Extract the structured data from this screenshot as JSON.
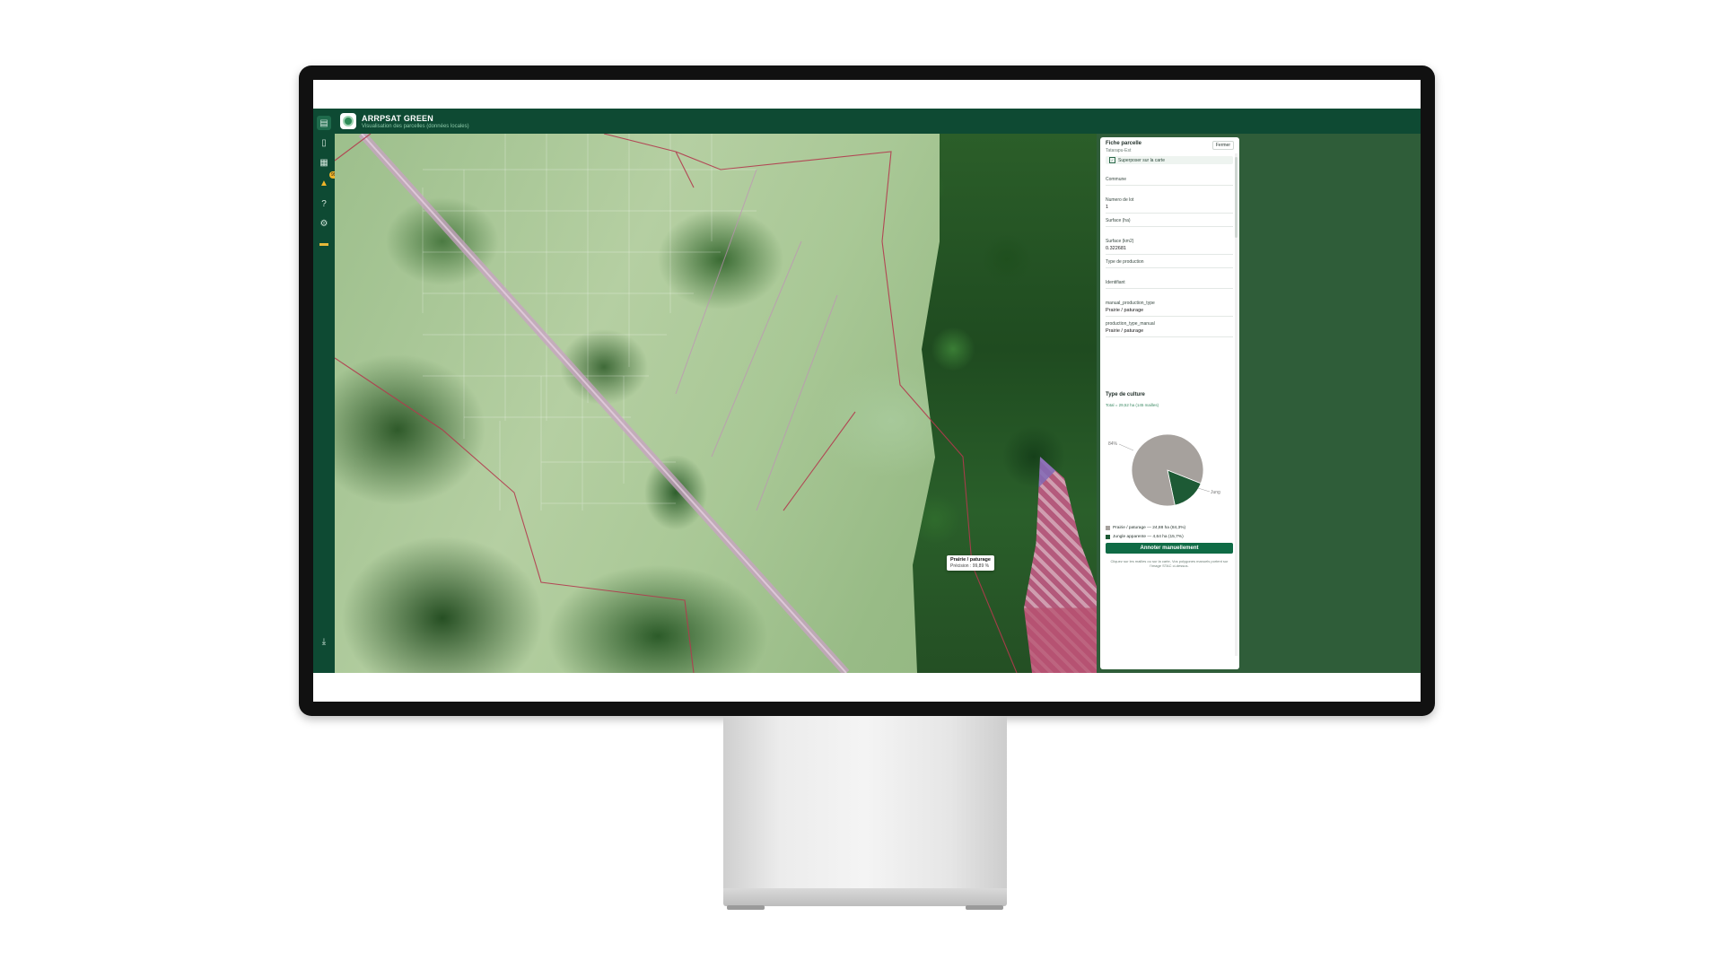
{
  "app": {
    "title": "ARRPSAT GREEN",
    "subtitle": "Visualisation des parcelles (données locales)"
  },
  "sidebar": {
    "items": [
      {
        "name": "layers-icon",
        "glyph": "▤"
      },
      {
        "name": "document-icon",
        "glyph": "▯"
      },
      {
        "name": "chart-icon",
        "glyph": "▦"
      },
      {
        "name": "alert-icon",
        "glyph": "▲",
        "badge": "99+"
      },
      {
        "name": "help-icon",
        "glyph": "?"
      },
      {
        "name": "gear-icon",
        "glyph": "⚙"
      },
      {
        "name": "ruler-icon",
        "glyph": "▬"
      }
    ],
    "download_glyph": "⤓"
  },
  "map": {
    "tooltip": {
      "label": "Prairie / paturage",
      "precision": "Précision : 99,89 %"
    }
  },
  "panel": {
    "title": "Fiche parcelle",
    "subtitle": "Tatarapu-Est",
    "close_label": "Fermer",
    "overlay_checkbox": "Superposer sur la carte",
    "fields": [
      {
        "label": "Commune",
        "value": ""
      },
      {
        "label": "Numero de lot",
        "value": "1"
      },
      {
        "label": "Surface (ha)",
        "value": ""
      },
      {
        "label": "Surface (km2)",
        "value": "0.322681"
      },
      {
        "label": "Type de production",
        "value": ""
      },
      {
        "label": "Identifiant",
        "value": ""
      },
      {
        "label": "manual_production_type",
        "value": "Prairie / paturage"
      },
      {
        "label": "production_type_manual",
        "value": "Prairie / paturage"
      }
    ],
    "culture_title": "Type de culture",
    "total_text": "Total = 29,52 ha (145 mailles)",
    "annotate_button": "Annoter manuellement",
    "help_text": "Cliquez sur les mailles ou sur la carte, Vos polygones manuels portent sur l'image STAC ci-dessus."
  },
  "chart_data": {
    "type": "pie",
    "categories": [
      "Prairie / paturage",
      "Jungle apparente"
    ],
    "values": [
      84.3,
      15.7
    ],
    "colors": [
      "#a6a19d",
      "#1d5a35"
    ],
    "slice_labels": [
      "84%",
      "Jung"
    ],
    "legend": [
      "Prairie / paturage — 24,88 ha (84,3%)",
      "Jungle apparente — 4,64 ha (15,7%)"
    ]
  }
}
